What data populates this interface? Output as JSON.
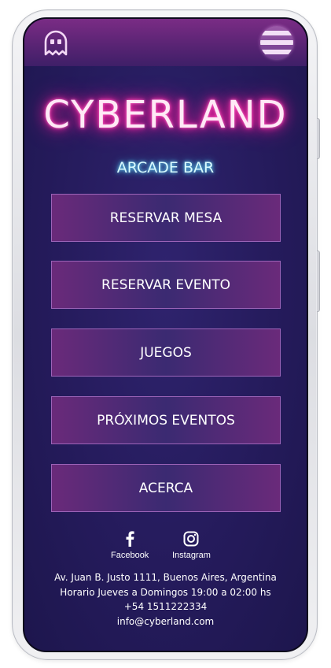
{
  "header": {
    "logo_icon": "ghost-icon",
    "menu_icon": "hamburger-menu-icon"
  },
  "brand": {
    "title": "CYBERLAND",
    "subtitle": "ARCADE BAR",
    "neon_pink": "#ff1a9a",
    "neon_cyan": "#3ccfff"
  },
  "nav": {
    "items": [
      {
        "label": "RESERVAR MESA"
      },
      {
        "label": "RESERVAR EVENTO"
      },
      {
        "label": "JUEGOS"
      },
      {
        "label": "PRÓXIMOS EVENTOS"
      },
      {
        "label": "ACERCA"
      }
    ]
  },
  "social": {
    "facebook": {
      "label": "Facebook",
      "icon": "facebook-icon"
    },
    "instagram": {
      "label": "Instagram",
      "icon": "instagram-icon"
    }
  },
  "footer": {
    "address": "Av. Juan B. Justo 1111, Buenos Aires, Argentina",
    "hours": "Horario Jueves a Domingos 19:00 a 02:00 hs",
    "phone": "+54 1511222334",
    "email": "info@cyberland.com"
  }
}
